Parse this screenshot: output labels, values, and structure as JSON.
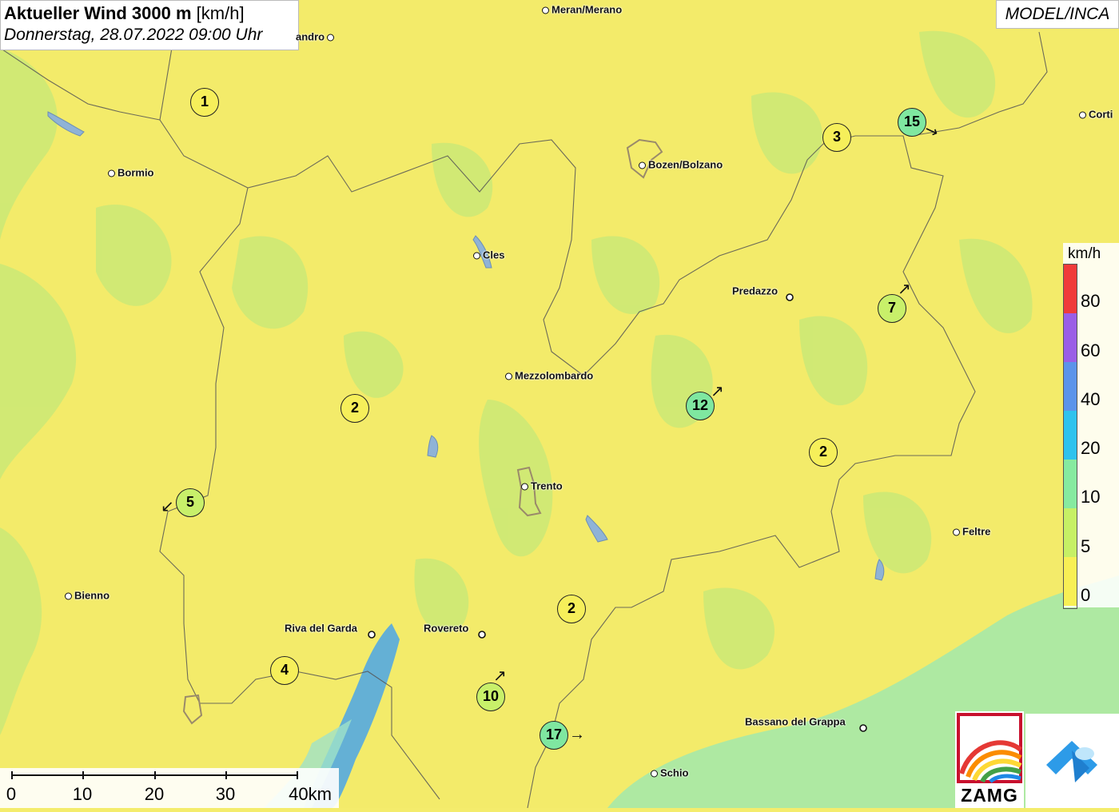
{
  "header": {
    "title_bold": "Aktueller Wind 3000 m",
    "title_unit": "[km/h]",
    "subtitle": "Donnerstag, 28.07.2022 09:00 Uhr",
    "model": "MODEL/INCA"
  },
  "towns": [
    {
      "name": "Meran/Merano"
    },
    {
      "name": "andro"
    },
    {
      "name": "Bormio"
    },
    {
      "name": "Bozen/Bolzano"
    },
    {
      "name": "Corti"
    },
    {
      "name": "Cles"
    },
    {
      "name": "Predazzo"
    },
    {
      "name": "Mezzolombardo"
    },
    {
      "name": "Trento"
    },
    {
      "name": "Feltre"
    },
    {
      "name": "Bienno"
    },
    {
      "name": "Riva del Garda"
    },
    {
      "name": "Rovereto"
    },
    {
      "name": "Bassano del Grappa"
    },
    {
      "name": "Schio"
    }
  ],
  "wind_markers": [
    {
      "value": "1",
      "color": "#f6ef5a"
    },
    {
      "value": "3",
      "color": "#f6ef5a"
    },
    {
      "value": "15",
      "color": "#7fe7a0"
    },
    {
      "value": "7",
      "color": "#c8f06a"
    },
    {
      "value": "2",
      "color": "#f6ef5a"
    },
    {
      "value": "12",
      "color": "#7fe7a0"
    },
    {
      "value": "2",
      "color": "#f6ef5a"
    },
    {
      "value": "5",
      "color": "#c8f06a"
    },
    {
      "value": "2",
      "color": "#f6ef5a"
    },
    {
      "value": "4",
      "color": "#f6ef5a"
    },
    {
      "value": "10",
      "color": "#c8f06a"
    },
    {
      "value": "17",
      "color": "#7fe7a0"
    }
  ],
  "legend": {
    "unit": "km/h",
    "labels": [
      "80",
      "60",
      "40",
      "20",
      "10",
      "5",
      "0"
    ],
    "colors": [
      "#f03a3a",
      "#9a5ee6",
      "#5b93ea",
      "#2ec2ee",
      "#86eaa0",
      "#c6f065",
      "#f8ef55"
    ]
  },
  "scale": {
    "labels": [
      "0",
      "10",
      "20",
      "30",
      "40km"
    ]
  },
  "logo": {
    "text": "ZAMG"
  }
}
